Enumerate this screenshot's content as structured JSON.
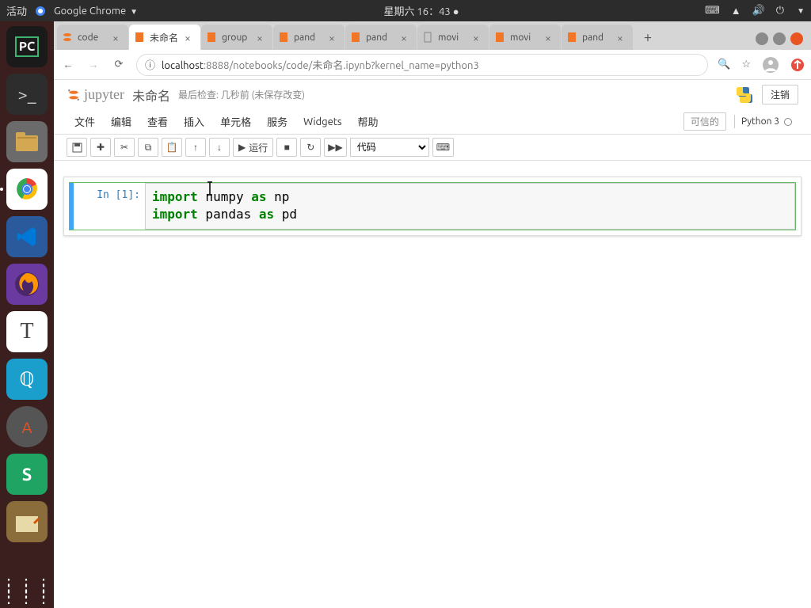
{
  "ubuntu": {
    "activities": "活动",
    "app": "Google Chrome",
    "clock": "星期六 16：43",
    "dot": "●"
  },
  "launcher": {
    "items": [
      {
        "name": "pycharm",
        "label": "PC"
      },
      {
        "name": "terminal",
        "label": ">_"
      },
      {
        "name": "files",
        "label": "📁"
      },
      {
        "name": "chrome",
        "label": "◯"
      },
      {
        "name": "vscode",
        "label": "⋈"
      },
      {
        "name": "firefox",
        "label": "🦊"
      },
      {
        "name": "text-editor",
        "label": "T"
      },
      {
        "name": "settings",
        "label": "⚙"
      },
      {
        "name": "updates",
        "label": "A"
      },
      {
        "name": "wps",
        "label": "S"
      },
      {
        "name": "notes",
        "label": "📝"
      }
    ]
  },
  "tabs": [
    {
      "title": "code",
      "favicon": "jupyter",
      "active": false
    },
    {
      "title": "未命名",
      "favicon": "notebook",
      "active": true
    },
    {
      "title": "group",
      "favicon": "notebook",
      "active": false
    },
    {
      "title": "pand",
      "favicon": "notebook",
      "active": false
    },
    {
      "title": "pand",
      "favicon": "notebook",
      "active": false
    },
    {
      "title": "movi",
      "favicon": "file",
      "active": false
    },
    {
      "title": "movi",
      "favicon": "notebook",
      "active": false
    },
    {
      "title": "pand",
      "favicon": "notebook",
      "active": false
    }
  ],
  "omnibox": {
    "host": "localhost",
    "path": ":8888/notebooks/code/未命名.ipynb?kernel_name=python3"
  },
  "jupyter": {
    "logo": "jupyter",
    "title": "未命名",
    "checkpoint": "最后检查: 几秒前 (未保存改变)",
    "logout": "注销",
    "trusted": "可信的",
    "kernel": "Python 3",
    "menus": [
      "文件",
      "编辑",
      "查看",
      "插入",
      "单元格",
      "服务",
      "Widgets",
      "帮助"
    ],
    "toolbar": {
      "run": "运行",
      "celltype": "代码"
    },
    "cell": {
      "prompt": "In [1]:",
      "line1_kw1": "import",
      "line1_mod": " numpy ",
      "line1_kw2": "as",
      "line1_alias": " np",
      "line2_kw1": "import",
      "line2_mod": " pandas ",
      "line2_kw2": "as",
      "line2_alias": " pd"
    }
  }
}
